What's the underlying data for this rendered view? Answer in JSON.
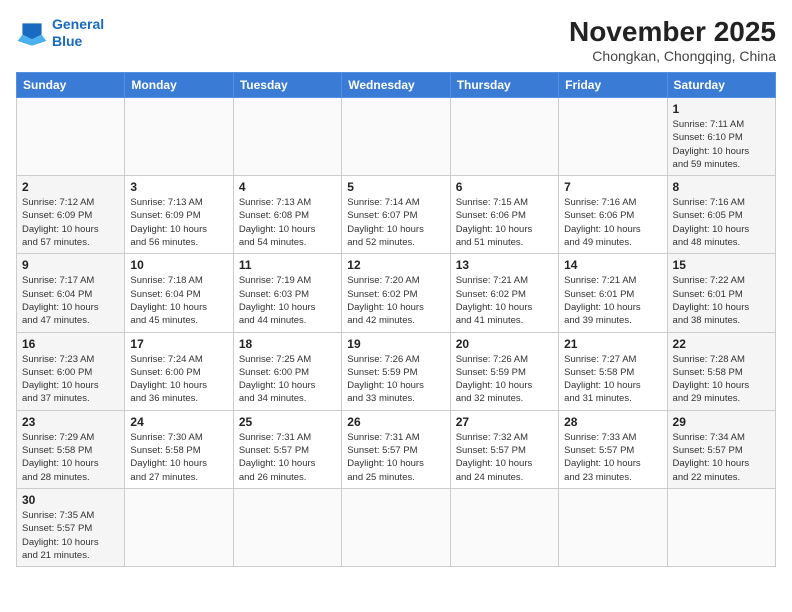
{
  "logo": {
    "line1": "General",
    "line2": "Blue"
  },
  "title": "November 2025",
  "location": "Chongkan, Chongqing, China",
  "days_of_week": [
    "Sunday",
    "Monday",
    "Tuesday",
    "Wednesday",
    "Thursday",
    "Friday",
    "Saturday"
  ],
  "weeks": [
    [
      {
        "day": "",
        "info": ""
      },
      {
        "day": "",
        "info": ""
      },
      {
        "day": "",
        "info": ""
      },
      {
        "day": "",
        "info": ""
      },
      {
        "day": "",
        "info": ""
      },
      {
        "day": "",
        "info": ""
      },
      {
        "day": "1",
        "info": "Sunrise: 7:11 AM\nSunset: 6:10 PM\nDaylight: 10 hours\nand 59 minutes."
      }
    ],
    [
      {
        "day": "2",
        "info": "Sunrise: 7:12 AM\nSunset: 6:09 PM\nDaylight: 10 hours\nand 57 minutes."
      },
      {
        "day": "3",
        "info": "Sunrise: 7:13 AM\nSunset: 6:09 PM\nDaylight: 10 hours\nand 56 minutes."
      },
      {
        "day": "4",
        "info": "Sunrise: 7:13 AM\nSunset: 6:08 PM\nDaylight: 10 hours\nand 54 minutes."
      },
      {
        "day": "5",
        "info": "Sunrise: 7:14 AM\nSunset: 6:07 PM\nDaylight: 10 hours\nand 52 minutes."
      },
      {
        "day": "6",
        "info": "Sunrise: 7:15 AM\nSunset: 6:06 PM\nDaylight: 10 hours\nand 51 minutes."
      },
      {
        "day": "7",
        "info": "Sunrise: 7:16 AM\nSunset: 6:06 PM\nDaylight: 10 hours\nand 49 minutes."
      },
      {
        "day": "8",
        "info": "Sunrise: 7:16 AM\nSunset: 6:05 PM\nDaylight: 10 hours\nand 48 minutes."
      }
    ],
    [
      {
        "day": "9",
        "info": "Sunrise: 7:17 AM\nSunset: 6:04 PM\nDaylight: 10 hours\nand 47 minutes."
      },
      {
        "day": "10",
        "info": "Sunrise: 7:18 AM\nSunset: 6:04 PM\nDaylight: 10 hours\nand 45 minutes."
      },
      {
        "day": "11",
        "info": "Sunrise: 7:19 AM\nSunset: 6:03 PM\nDaylight: 10 hours\nand 44 minutes."
      },
      {
        "day": "12",
        "info": "Sunrise: 7:20 AM\nSunset: 6:02 PM\nDaylight: 10 hours\nand 42 minutes."
      },
      {
        "day": "13",
        "info": "Sunrise: 7:21 AM\nSunset: 6:02 PM\nDaylight: 10 hours\nand 41 minutes."
      },
      {
        "day": "14",
        "info": "Sunrise: 7:21 AM\nSunset: 6:01 PM\nDaylight: 10 hours\nand 39 minutes."
      },
      {
        "day": "15",
        "info": "Sunrise: 7:22 AM\nSunset: 6:01 PM\nDaylight: 10 hours\nand 38 minutes."
      }
    ],
    [
      {
        "day": "16",
        "info": "Sunrise: 7:23 AM\nSunset: 6:00 PM\nDaylight: 10 hours\nand 37 minutes."
      },
      {
        "day": "17",
        "info": "Sunrise: 7:24 AM\nSunset: 6:00 PM\nDaylight: 10 hours\nand 36 minutes."
      },
      {
        "day": "18",
        "info": "Sunrise: 7:25 AM\nSunset: 6:00 PM\nDaylight: 10 hours\nand 34 minutes."
      },
      {
        "day": "19",
        "info": "Sunrise: 7:26 AM\nSunset: 5:59 PM\nDaylight: 10 hours\nand 33 minutes."
      },
      {
        "day": "20",
        "info": "Sunrise: 7:26 AM\nSunset: 5:59 PM\nDaylight: 10 hours\nand 32 minutes."
      },
      {
        "day": "21",
        "info": "Sunrise: 7:27 AM\nSunset: 5:58 PM\nDaylight: 10 hours\nand 31 minutes."
      },
      {
        "day": "22",
        "info": "Sunrise: 7:28 AM\nSunset: 5:58 PM\nDaylight: 10 hours\nand 29 minutes."
      }
    ],
    [
      {
        "day": "23",
        "info": "Sunrise: 7:29 AM\nSunset: 5:58 PM\nDaylight: 10 hours\nand 28 minutes."
      },
      {
        "day": "24",
        "info": "Sunrise: 7:30 AM\nSunset: 5:58 PM\nDaylight: 10 hours\nand 27 minutes."
      },
      {
        "day": "25",
        "info": "Sunrise: 7:31 AM\nSunset: 5:57 PM\nDaylight: 10 hours\nand 26 minutes."
      },
      {
        "day": "26",
        "info": "Sunrise: 7:31 AM\nSunset: 5:57 PM\nDaylight: 10 hours\nand 25 minutes."
      },
      {
        "day": "27",
        "info": "Sunrise: 7:32 AM\nSunset: 5:57 PM\nDaylight: 10 hours\nand 24 minutes."
      },
      {
        "day": "28",
        "info": "Sunrise: 7:33 AM\nSunset: 5:57 PM\nDaylight: 10 hours\nand 23 minutes."
      },
      {
        "day": "29",
        "info": "Sunrise: 7:34 AM\nSunset: 5:57 PM\nDaylight: 10 hours\nand 22 minutes."
      }
    ],
    [
      {
        "day": "30",
        "info": "Sunrise: 7:35 AM\nSunset: 5:57 PM\nDaylight: 10 hours\nand 21 minutes."
      },
      {
        "day": "",
        "info": ""
      },
      {
        "day": "",
        "info": ""
      },
      {
        "day": "",
        "info": ""
      },
      {
        "day": "",
        "info": ""
      },
      {
        "day": "",
        "info": ""
      },
      {
        "day": "",
        "info": ""
      }
    ]
  ]
}
